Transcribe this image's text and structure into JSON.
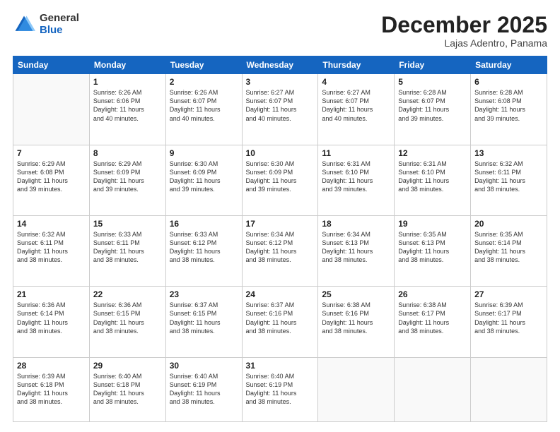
{
  "header": {
    "logo_general": "General",
    "logo_blue": "Blue",
    "month_title": "December 2025",
    "location": "Lajas Adentro, Panama"
  },
  "days_of_week": [
    "Sunday",
    "Monday",
    "Tuesday",
    "Wednesday",
    "Thursday",
    "Friday",
    "Saturday"
  ],
  "weeks": [
    [
      {
        "day": "",
        "info": ""
      },
      {
        "day": "1",
        "info": "Sunrise: 6:26 AM\nSunset: 6:06 PM\nDaylight: 11 hours\nand 40 minutes."
      },
      {
        "day": "2",
        "info": "Sunrise: 6:26 AM\nSunset: 6:07 PM\nDaylight: 11 hours\nand 40 minutes."
      },
      {
        "day": "3",
        "info": "Sunrise: 6:27 AM\nSunset: 6:07 PM\nDaylight: 11 hours\nand 40 minutes."
      },
      {
        "day": "4",
        "info": "Sunrise: 6:27 AM\nSunset: 6:07 PM\nDaylight: 11 hours\nand 40 minutes."
      },
      {
        "day": "5",
        "info": "Sunrise: 6:28 AM\nSunset: 6:07 PM\nDaylight: 11 hours\nand 39 minutes."
      },
      {
        "day": "6",
        "info": "Sunrise: 6:28 AM\nSunset: 6:08 PM\nDaylight: 11 hours\nand 39 minutes."
      }
    ],
    [
      {
        "day": "7",
        "info": "Sunrise: 6:29 AM\nSunset: 6:08 PM\nDaylight: 11 hours\nand 39 minutes."
      },
      {
        "day": "8",
        "info": "Sunrise: 6:29 AM\nSunset: 6:09 PM\nDaylight: 11 hours\nand 39 minutes."
      },
      {
        "day": "9",
        "info": "Sunrise: 6:30 AM\nSunset: 6:09 PM\nDaylight: 11 hours\nand 39 minutes."
      },
      {
        "day": "10",
        "info": "Sunrise: 6:30 AM\nSunset: 6:09 PM\nDaylight: 11 hours\nand 39 minutes."
      },
      {
        "day": "11",
        "info": "Sunrise: 6:31 AM\nSunset: 6:10 PM\nDaylight: 11 hours\nand 39 minutes."
      },
      {
        "day": "12",
        "info": "Sunrise: 6:31 AM\nSunset: 6:10 PM\nDaylight: 11 hours\nand 38 minutes."
      },
      {
        "day": "13",
        "info": "Sunrise: 6:32 AM\nSunset: 6:11 PM\nDaylight: 11 hours\nand 38 minutes."
      }
    ],
    [
      {
        "day": "14",
        "info": "Sunrise: 6:32 AM\nSunset: 6:11 PM\nDaylight: 11 hours\nand 38 minutes."
      },
      {
        "day": "15",
        "info": "Sunrise: 6:33 AM\nSunset: 6:11 PM\nDaylight: 11 hours\nand 38 minutes."
      },
      {
        "day": "16",
        "info": "Sunrise: 6:33 AM\nSunset: 6:12 PM\nDaylight: 11 hours\nand 38 minutes."
      },
      {
        "day": "17",
        "info": "Sunrise: 6:34 AM\nSunset: 6:12 PM\nDaylight: 11 hours\nand 38 minutes."
      },
      {
        "day": "18",
        "info": "Sunrise: 6:34 AM\nSunset: 6:13 PM\nDaylight: 11 hours\nand 38 minutes."
      },
      {
        "day": "19",
        "info": "Sunrise: 6:35 AM\nSunset: 6:13 PM\nDaylight: 11 hours\nand 38 minutes."
      },
      {
        "day": "20",
        "info": "Sunrise: 6:35 AM\nSunset: 6:14 PM\nDaylight: 11 hours\nand 38 minutes."
      }
    ],
    [
      {
        "day": "21",
        "info": "Sunrise: 6:36 AM\nSunset: 6:14 PM\nDaylight: 11 hours\nand 38 minutes."
      },
      {
        "day": "22",
        "info": "Sunrise: 6:36 AM\nSunset: 6:15 PM\nDaylight: 11 hours\nand 38 minutes."
      },
      {
        "day": "23",
        "info": "Sunrise: 6:37 AM\nSunset: 6:15 PM\nDaylight: 11 hours\nand 38 minutes."
      },
      {
        "day": "24",
        "info": "Sunrise: 6:37 AM\nSunset: 6:16 PM\nDaylight: 11 hours\nand 38 minutes."
      },
      {
        "day": "25",
        "info": "Sunrise: 6:38 AM\nSunset: 6:16 PM\nDaylight: 11 hours\nand 38 minutes."
      },
      {
        "day": "26",
        "info": "Sunrise: 6:38 AM\nSunset: 6:17 PM\nDaylight: 11 hours\nand 38 minutes."
      },
      {
        "day": "27",
        "info": "Sunrise: 6:39 AM\nSunset: 6:17 PM\nDaylight: 11 hours\nand 38 minutes."
      }
    ],
    [
      {
        "day": "28",
        "info": "Sunrise: 6:39 AM\nSunset: 6:18 PM\nDaylight: 11 hours\nand 38 minutes."
      },
      {
        "day": "29",
        "info": "Sunrise: 6:40 AM\nSunset: 6:18 PM\nDaylight: 11 hours\nand 38 minutes."
      },
      {
        "day": "30",
        "info": "Sunrise: 6:40 AM\nSunset: 6:19 PM\nDaylight: 11 hours\nand 38 minutes."
      },
      {
        "day": "31",
        "info": "Sunrise: 6:40 AM\nSunset: 6:19 PM\nDaylight: 11 hours\nand 38 minutes."
      },
      {
        "day": "",
        "info": ""
      },
      {
        "day": "",
        "info": ""
      },
      {
        "day": "",
        "info": ""
      }
    ]
  ]
}
